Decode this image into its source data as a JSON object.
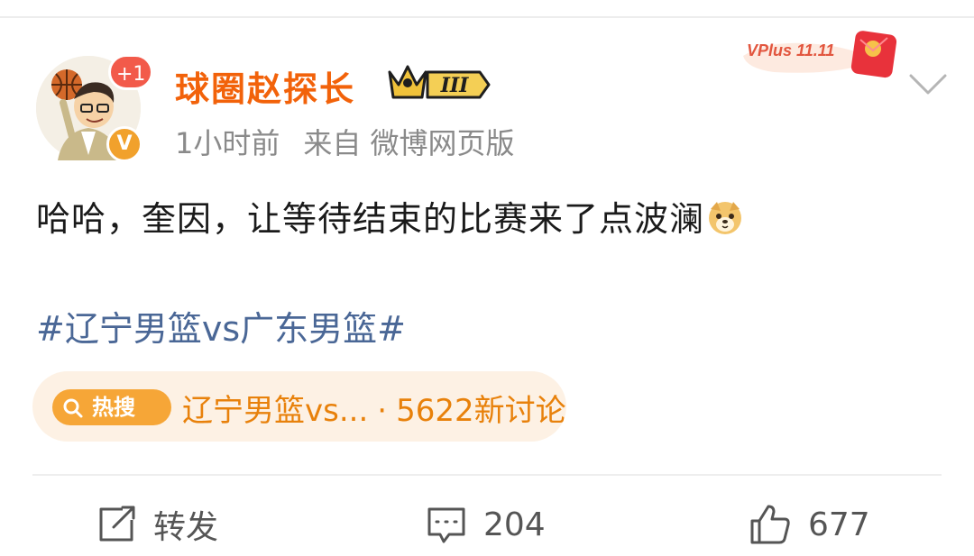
{
  "user": {
    "name": "球圈赵探长",
    "notification_badge": "+1",
    "verified_mark": "V",
    "vip_level": "III"
  },
  "meta": {
    "time": "1小时前",
    "source": "来自 微博网页版"
  },
  "promo": {
    "text": "VPlus 11.11"
  },
  "post": {
    "text": "哈哈，奎因，让等待结束的比赛来了点波澜",
    "emoji": "doge-emoji",
    "hashtag": "#辽宁男篮vs广东男篮#"
  },
  "hot_search": {
    "badge": "热搜",
    "topic": "辽宁男篮vs...",
    "separator": "·",
    "count_text": "5622新讨论"
  },
  "actions": {
    "share_label": "转发",
    "comment_count": "204",
    "like_count": "677"
  },
  "colors": {
    "username": "#f2620a",
    "hashtag": "#4a6796",
    "hot_text": "#e8810b",
    "hot_bg": "#fdf1e4",
    "hot_pill": "#f6a637"
  },
  "icons": [
    "chevron-down-icon",
    "share-icon",
    "comment-icon",
    "like-icon",
    "search-icon",
    "crown-icon"
  ]
}
